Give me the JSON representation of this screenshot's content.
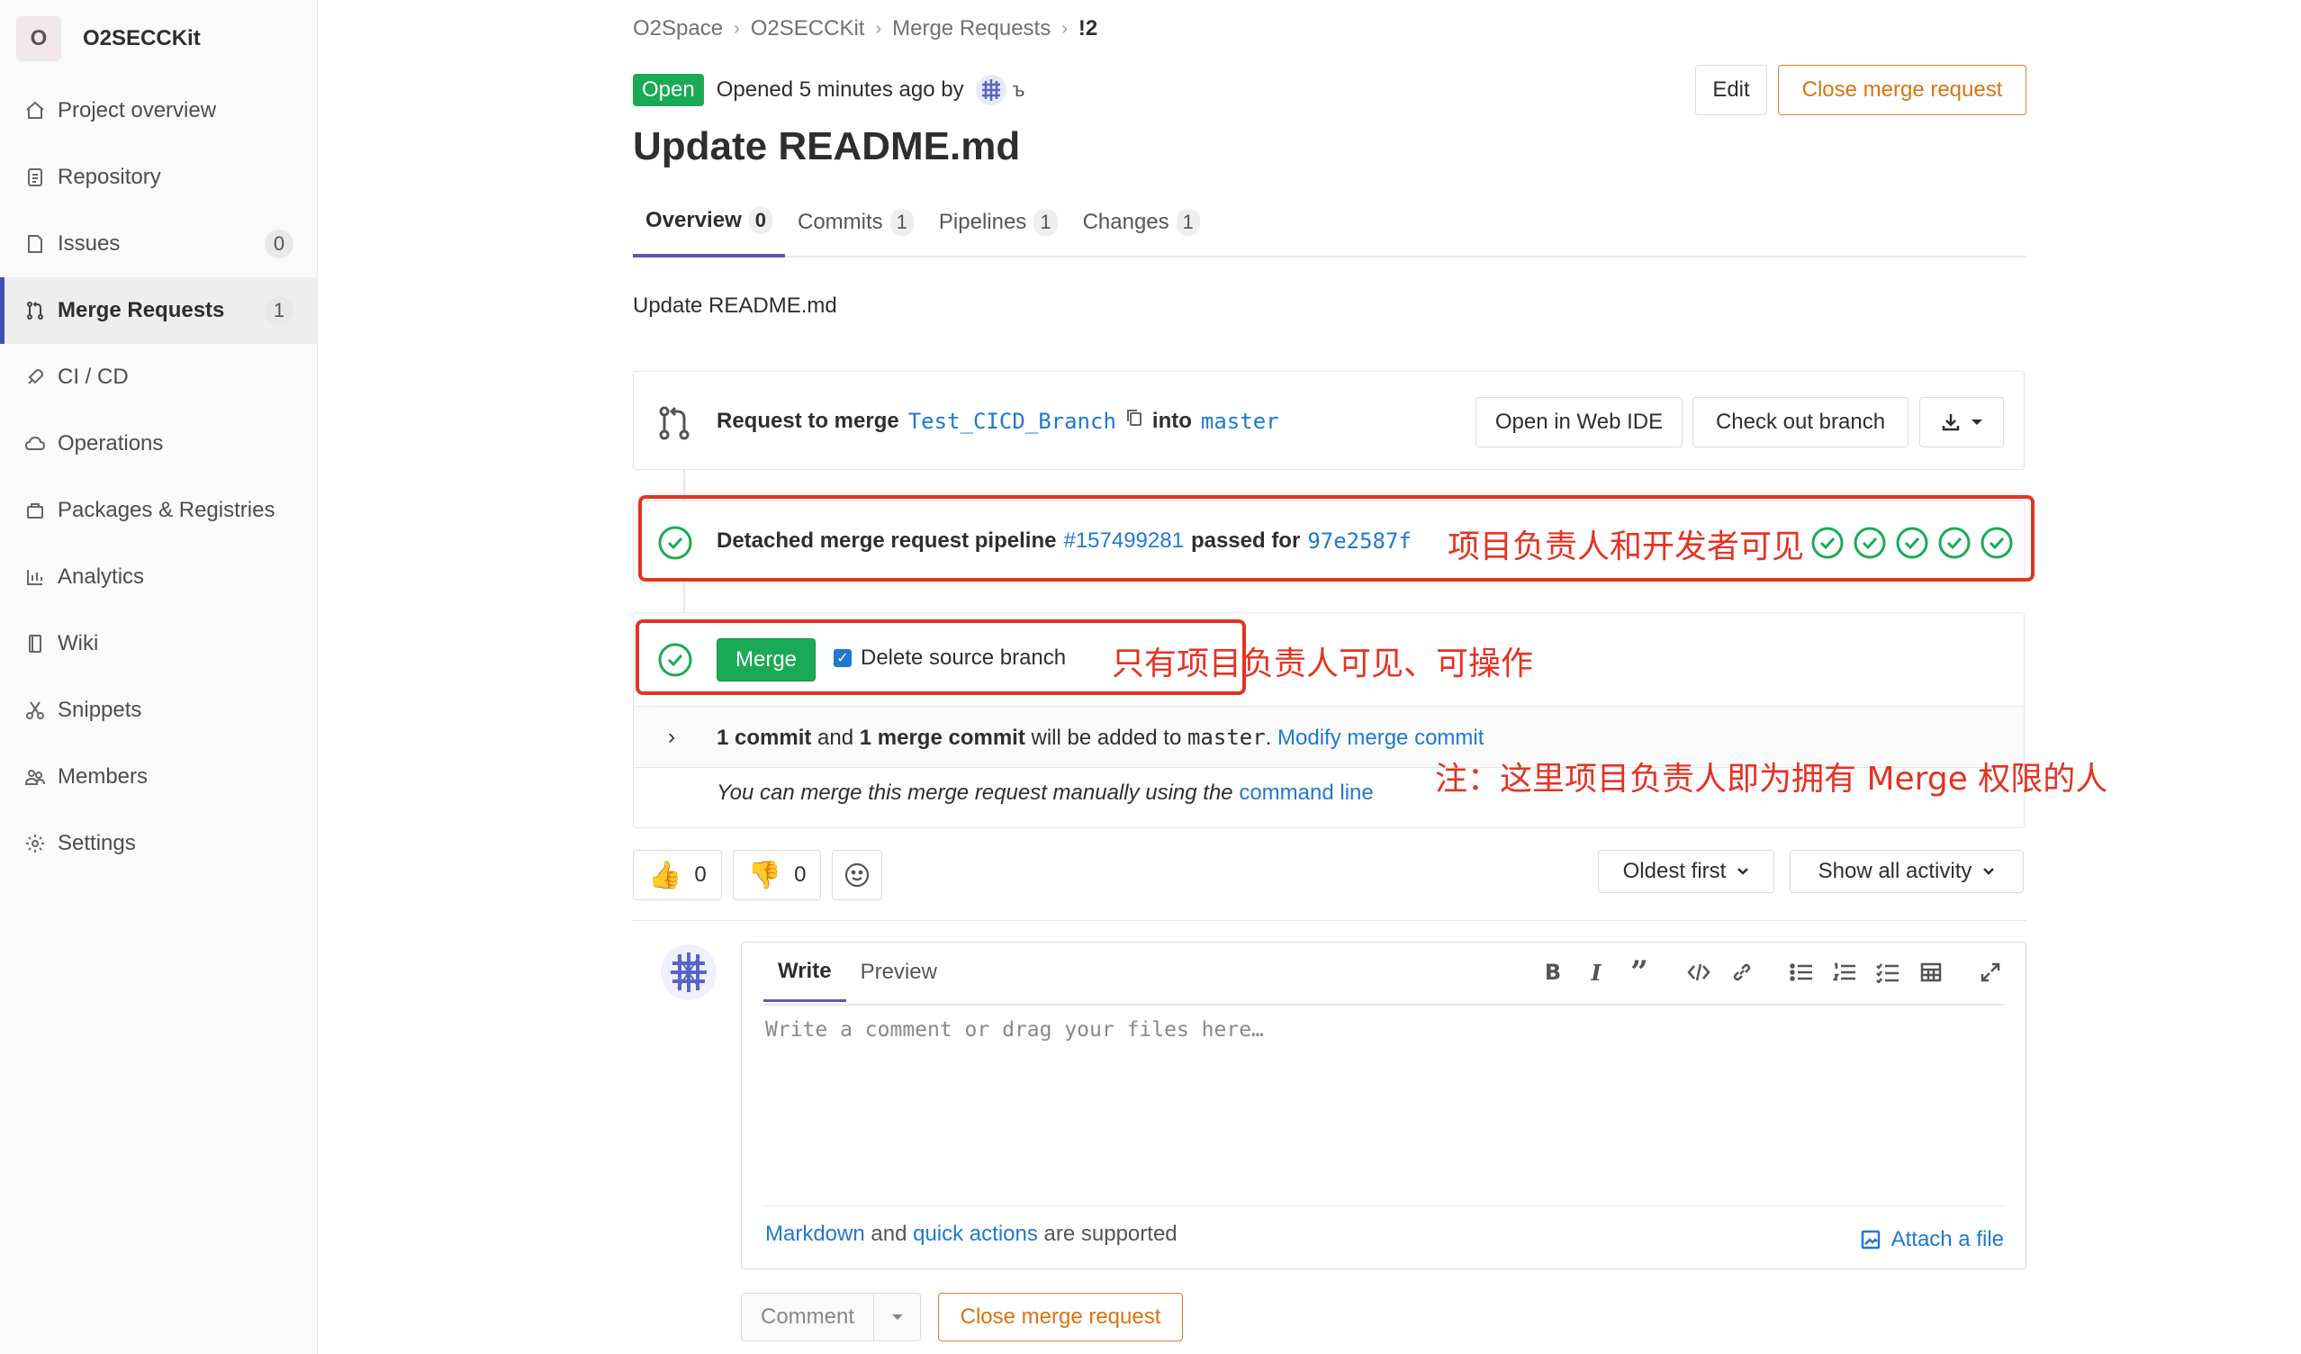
{
  "sidebar": {
    "project_initial": "O",
    "project_name": "O2SECCKit",
    "items": [
      {
        "label": "Project overview",
        "icon": "home-icon"
      },
      {
        "label": "Repository",
        "icon": "doc-icon"
      },
      {
        "label": "Issues",
        "icon": "issues-icon",
        "badge": "0"
      },
      {
        "label": "Merge Requests",
        "icon": "merge-request-icon",
        "badge": "1",
        "active": true
      },
      {
        "label": "CI / CD",
        "icon": "rocket-icon"
      },
      {
        "label": "Operations",
        "icon": "cloud-icon"
      },
      {
        "label": "Packages & Registries",
        "icon": "package-icon"
      },
      {
        "label": "Analytics",
        "icon": "chart-icon"
      },
      {
        "label": "Wiki",
        "icon": "book-icon"
      },
      {
        "label": "Snippets",
        "icon": "scissors-icon"
      },
      {
        "label": "Members",
        "icon": "users-icon"
      },
      {
        "label": "Settings",
        "icon": "gear-icon"
      }
    ]
  },
  "breadcrumb": [
    "O2Space",
    "O2SECCKit",
    "Merge Requests",
    "!2"
  ],
  "header": {
    "status": "Open",
    "opened_text": "Opened 5 minutes ago by",
    "author_initial": "ъ",
    "edit_label": "Edit",
    "close_label": "Close merge request",
    "title": "Update README.md"
  },
  "tabs": [
    {
      "label": "Overview",
      "count": "0"
    },
    {
      "label": "Commits",
      "count": "1"
    },
    {
      "label": "Pipelines",
      "count": "1"
    },
    {
      "label": "Changes",
      "count": "1"
    }
  ],
  "description": "Update README.md",
  "request": {
    "prefix": "Request to merge",
    "source_branch": "Test_CICD_Branch",
    "into": "into",
    "target_branch": "master",
    "web_ide_label": "Open in Web IDE",
    "checkout_label": "Check out branch"
  },
  "pipeline": {
    "prefix": "Detached merge request pipeline",
    "id": "#157499281",
    "middle": "passed for",
    "commit": "97e2587f"
  },
  "merge": {
    "button_label": "Merge",
    "delete_source_label": "Delete source branch",
    "commit_count": "1 commit",
    "and": "and",
    "merge_commit": "1 merge commit",
    "added_to": "will be added to",
    "target": "master",
    "modify_link": "Modify merge commit",
    "manual_text": "You can merge this merge request manually using the",
    "command_line_link": "command line"
  },
  "reactions": {
    "thumbs_up_count": "0",
    "thumbs_down_count": "0"
  },
  "sort": {
    "order_label": "Oldest first",
    "filter_label": "Show all activity"
  },
  "editor": {
    "write_tab": "Write",
    "preview_tab": "Preview",
    "placeholder": "Write a comment or drag your files here…",
    "markdown_link": "Markdown",
    "and": "and",
    "quick_actions_link": "quick actions",
    "supported": "are supported",
    "attach_label": "Attach a file"
  },
  "footer": {
    "comment_label": "Comment",
    "close_label": "Close merge request"
  },
  "annotations": {
    "pipeline_note": "项目负责人和开发者可见",
    "merge_note": "只有项目负责人可见、可操作",
    "footnote": "注：这里项目负责人即为拥有 Merge 权限的人"
  },
  "colors": {
    "success": "#1aaa55",
    "link": "#1f78d1",
    "warning": "#d9730d",
    "annotation": "#e53222",
    "active_tab": "#6b4fbb"
  }
}
